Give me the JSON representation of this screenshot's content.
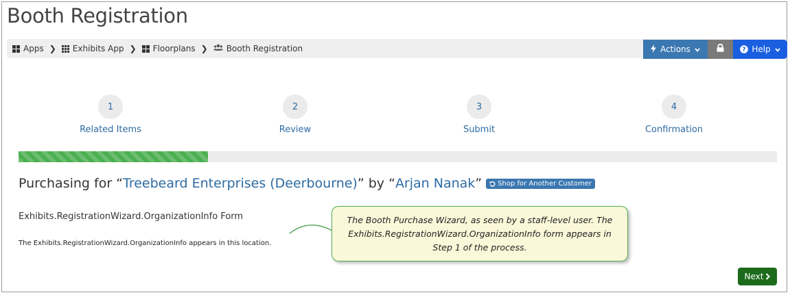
{
  "page": {
    "title": "Booth Registration"
  },
  "breadcrumb": [
    {
      "label": "Apps",
      "icon": "grid-icon"
    },
    {
      "label": "Exhibits App",
      "icon": "grid-small-icon"
    },
    {
      "label": "Floorplans",
      "icon": "grid-icon"
    },
    {
      "label": "Booth Registration",
      "icon": "users-icon"
    }
  ],
  "toolbar": {
    "actions_label": "Actions",
    "help_label": "Help"
  },
  "steps": [
    {
      "number": "1",
      "label": "Related Items"
    },
    {
      "number": "2",
      "label": "Review"
    },
    {
      "number": "3",
      "label": "Submit"
    },
    {
      "number": "4",
      "label": "Confirmation"
    }
  ],
  "progress": {
    "percent": 25,
    "color": "#4caf50"
  },
  "purchasing": {
    "prefix": "Purchasing for “",
    "customer": "Treebeard Enterprises (Deerbourne)",
    "middle": "” by “",
    "user": "Arjan Nanak",
    "suffix": "”",
    "shop_button": "Shop for Another Customer"
  },
  "form": {
    "title": "Exhibits.RegistrationWizard.OrganizationInfo Form",
    "description": "The Exhibits.RegistrationWizard.OrganizationInfo appears in this location."
  },
  "callout": {
    "text": "The Booth Purchase Wizard, as seen by a staff-level user. The Exhibits.RegistrationWizard.OrganizationInfo form appears in Step 1 of the process."
  },
  "next_button": {
    "label": "Next"
  },
  "colors": {
    "accent": "#3b77b0",
    "help": "#1a5fe0",
    "link": "#2d6ba3",
    "next": "#1c6b1c"
  }
}
